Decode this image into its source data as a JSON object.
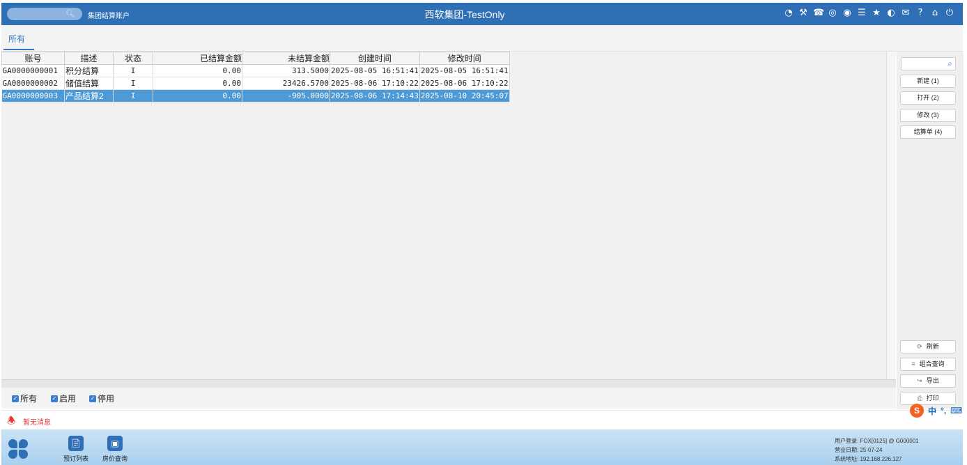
{
  "titlebar": {
    "tab_label": "集团结算账户",
    "title": "西软集团-TestOnly",
    "icons": [
      "wifi-icon",
      "tools-icon",
      "phone-icon",
      "help-bubble-icon",
      "palette-icon",
      "menu-icon",
      "star-icon",
      "theme-icon",
      "mail-icon",
      "question-icon",
      "home-icon",
      "power-icon"
    ]
  },
  "tabs": {
    "all": "所有"
  },
  "grid": {
    "columns": [
      "账号",
      "描述",
      "状态",
      "已结算金额",
      "未结算金额",
      "创建时间",
      "修改时间"
    ],
    "rows": [
      {
        "account": "GA0000000001",
        "desc": "积分结算",
        "status": "I",
        "settled": "0.00",
        "unsettled": "313.5000",
        "created": "2025-08-05 16:51:41",
        "modified": "2025-08-05 16:51:41"
      },
      {
        "account": "GA0000000002",
        "desc": "储值结算",
        "status": "I",
        "settled": "0.00",
        "unsettled": "23426.5700",
        "created": "2025-08-06 17:10:22",
        "modified": "2025-08-06 17:10:22"
      },
      {
        "account": "GA0000000003",
        "desc": "产品结算2",
        "status": "I",
        "settled": "0.00",
        "unsettled": "-905.0000",
        "created": "2025-08-06 17:14:43",
        "modified": "2025-08-10 20:45:07"
      }
    ],
    "selected_row": 2
  },
  "right_panel": {
    "new": "新建 (1)",
    "open": "打开 (2)",
    "edit": "修改 (3)",
    "statement": "结算单 (4)",
    "refresh": "刷新",
    "combo_query": "组合查询",
    "export": "导出",
    "print": "打印"
  },
  "filters": {
    "all": "所有",
    "enabled": "启用",
    "disabled": "停用"
  },
  "message": "暂无消息",
  "ime": {
    "brand": "S",
    "lang": "中",
    "punct": "°,",
    "keyboard": "⌨"
  },
  "footer": {
    "booking_list": "预订列表",
    "rate_query": "房价查询",
    "user_login": "用户登录:  FOX[0125] @ G000001",
    "business_date": "营业日期:  25-07-24",
    "system_address": "系统地址:  192.168.226.127"
  }
}
